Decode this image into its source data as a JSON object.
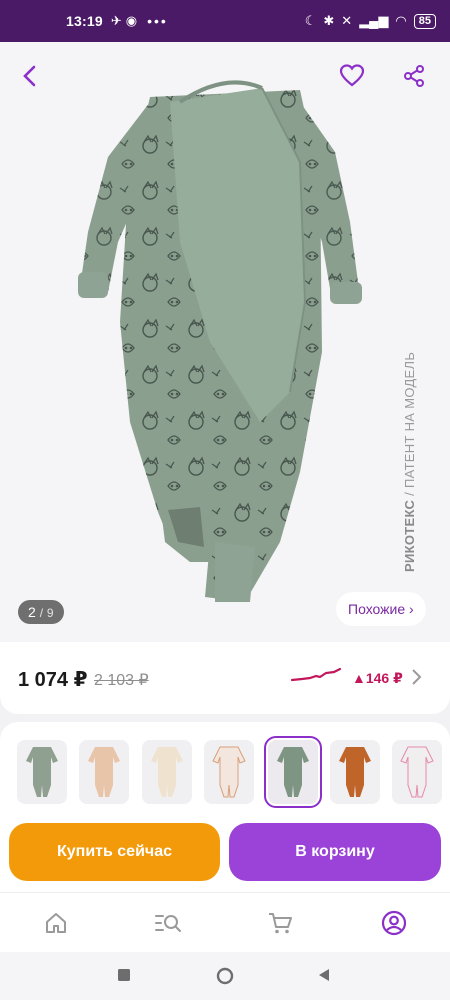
{
  "status": {
    "time": "13:19",
    "battery": "85"
  },
  "gallery": {
    "counter_current": "2",
    "counter_sep": "/",
    "counter_total": "9",
    "similar_label": "Похожие ›",
    "watermark_brand": "РИКОТЕКС",
    "watermark_text": " / ПАТЕНТ НА МОДЕЛЬ"
  },
  "price": {
    "current": "1 074 ₽",
    "old": "2 103 ₽",
    "delta": "▲146 ₽"
  },
  "thumbnails": [
    {
      "name": "thumb-green-print",
      "color": "#8fa090",
      "selected": false
    },
    {
      "name": "thumb-peach-print",
      "color": "#e8c4a8",
      "selected": false
    },
    {
      "name": "thumb-cream-print",
      "color": "#efe3cf",
      "selected": false
    },
    {
      "name": "thumb-white-fox",
      "color": "#f2e6de",
      "selected": false
    },
    {
      "name": "thumb-green-animals",
      "color": "#7f9583",
      "selected": true
    },
    {
      "name": "thumb-rust",
      "color": "#c0652a",
      "selected": false
    },
    {
      "name": "thumb-white-pink",
      "color": "#f1eef0",
      "selected": false
    }
  ],
  "actions": {
    "buy_now": "Купить сейчас",
    "add_to_cart": "В корзину"
  },
  "nav": {
    "items": [
      "home-icon",
      "catalog-search-icon",
      "cart-icon",
      "profile-icon"
    ]
  },
  "colors": {
    "statusbar": "#4b1a66",
    "accent": "#8b2fc9",
    "buy": "#f39a0a",
    "cart": "#9b43d9",
    "price_up": "#c2185b",
    "garment": "#8b9f8f"
  }
}
